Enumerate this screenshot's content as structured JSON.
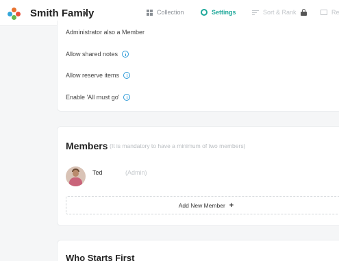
{
  "header": {
    "family_name": "Smith Family",
    "tabs": {
      "collection": "Collection",
      "settings": "Settings",
      "sort_rank": "Sort & Rank",
      "rep": "Rep"
    },
    "active_tab": "settings",
    "accent_color": "#1fa89a"
  },
  "settings": {
    "items": [
      {
        "label": "Administrator also a Member",
        "info": false
      },
      {
        "label": "Allow shared notes",
        "info": true
      },
      {
        "label": "Allow reserve items",
        "info": true
      },
      {
        "label": "Enable 'All must go'",
        "info": true
      }
    ]
  },
  "members": {
    "title": "Members",
    "note": "(It is mandatory to have a minimum of two members)",
    "list": [
      {
        "name": "Ted",
        "role": "(Admin)"
      }
    ],
    "add_label": "Add New Member",
    "add_icon": "+"
  },
  "who_starts": {
    "title": "Who Starts First"
  }
}
